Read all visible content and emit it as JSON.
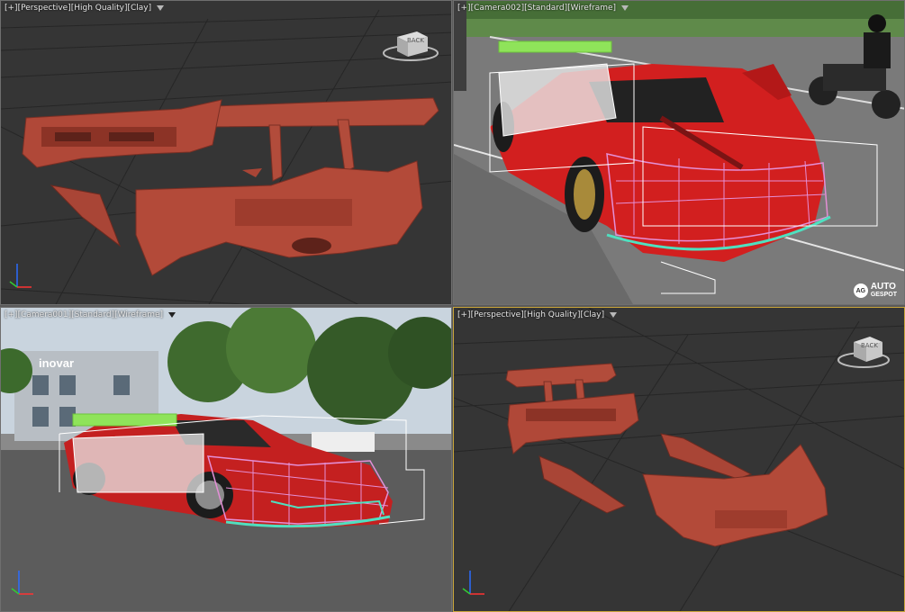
{
  "viewports": {
    "top_left": {
      "plus": "[+]",
      "view": "[Perspective]",
      "quality": "[High Quality]",
      "shading": "[Clay]"
    },
    "top_right": {
      "plus": "[+]",
      "view": "[Camera002]",
      "quality": "[Standard]",
      "shading": "[Wireframe]"
    },
    "bottom_left": {
      "plus": "[+]",
      "view": "[Camera001]",
      "quality": "[Standard]",
      "shading": "[Wireframe]"
    },
    "bottom_right": {
      "plus": "[+]",
      "view": "[Perspective]",
      "quality": "[High Quality]",
      "shading": "[Clay]"
    }
  },
  "viewcube_label": "BACK",
  "building_sign": "inovar",
  "watermark": {
    "line1": "AUTO",
    "line2": "GESPOT"
  },
  "colors": {
    "clay": "#b14a39",
    "grid_bg": "#353535",
    "active_border": "#c9a53a",
    "wire_pink": "#e48fd6",
    "wire_cyan": "#4fe0c0",
    "wire_green": "#8fe35a",
    "car_red": "#d21f1f"
  }
}
